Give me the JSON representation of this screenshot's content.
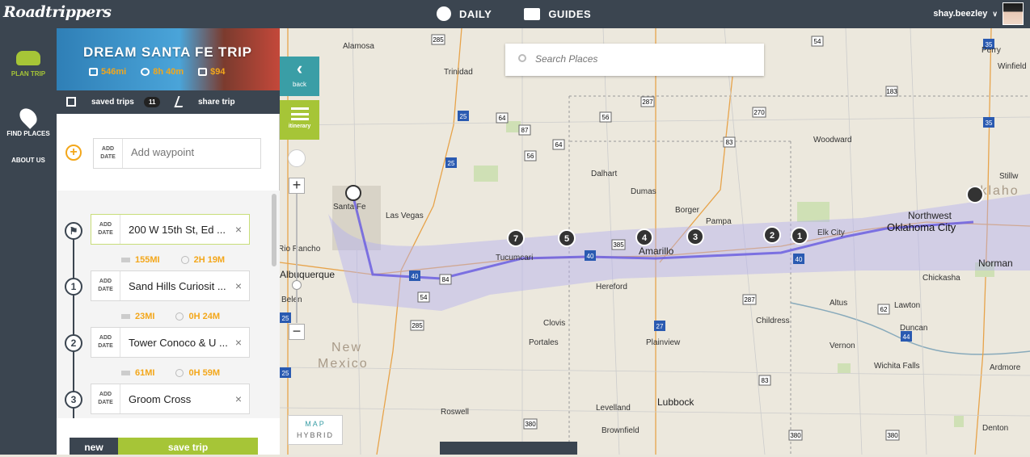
{
  "topbar": {
    "logo": "Roadtrippers",
    "nav": [
      {
        "label": "DAILY",
        "icon": "compass-icon"
      },
      {
        "label": "GUIDES",
        "icon": "book-icon"
      }
    ],
    "username": "shay.beezley"
  },
  "rail": {
    "items": [
      {
        "label": "PLAN TRIP",
        "icon": "car-icon",
        "active": true
      },
      {
        "label": "FIND PLACES",
        "icon": "map-pin-icon",
        "active": false
      },
      {
        "label": "ABOUT US",
        "active": false
      }
    ]
  },
  "trip": {
    "title": "DREAM SANTA FE TRIP",
    "distance": "546mi",
    "duration": "8h 40m",
    "cost": "$94"
  },
  "subbar": {
    "saved_label": "saved trips",
    "saved_count": "11",
    "share_label": "share trip"
  },
  "add_waypoint": {
    "date_label_1": "ADD",
    "date_label_2": "DATE",
    "placeholder": "Add waypoint"
  },
  "stops": [
    {
      "marker": "flag",
      "name": "200 W 15th St, Ed ...",
      "leg_distance": "155MI",
      "leg_time": "2H 19M"
    },
    {
      "marker": "1",
      "name": "Sand Hills Curiosit ...",
      "leg_distance": "23MI",
      "leg_time": "0H 24M"
    },
    {
      "marker": "2",
      "name": "Tower Conoco & U ...",
      "leg_distance": "61MI",
      "leg_time": "0H 59M"
    },
    {
      "marker": "3",
      "name": "Groom Cross"
    }
  ],
  "actions": {
    "new_label": "new",
    "save_label": "save trip"
  },
  "map": {
    "search_placeholder": "Search Places",
    "back_label": "back",
    "itinerary_label": "itinerary",
    "maptype_map": "MAP",
    "maptype_hybrid": "HYBRID",
    "states": [
      "New",
      "Mexico",
      "Oklaho"
    ],
    "cities": [
      "Alamosa",
      "Trinidad",
      "Woodward",
      "Winfield",
      "Stillw",
      "Santa Fe",
      "Las Vegas",
      "Dalhart",
      "Dumas",
      "Borger",
      "Pampa",
      "Elk City",
      "Northwest",
      "Oklahoma City",
      "Tucumcari",
      "Amarillo",
      "Hereford",
      "Clovis",
      "Portales",
      "Plainview",
      "Childress",
      "Altus",
      "Lawton",
      "Duncan",
      "Ardmore",
      "Vernon",
      "Wichita Falls",
      "Lubbock",
      "Levelland",
      "Roswell",
      "Brownfield",
      "Denton",
      "Norman",
      "Chickasha",
      "Albuquerque",
      "Rio Rancho",
      "Belen",
      "Perry"
    ],
    "markers": [
      "7",
      "5",
      "4",
      "3",
      "2",
      "1"
    ]
  },
  "colors": {
    "dark": "#3b4550",
    "green": "#a6c537",
    "teal": "#3a9ea6",
    "orange": "#f3a71b",
    "route": "#7766dd"
  }
}
